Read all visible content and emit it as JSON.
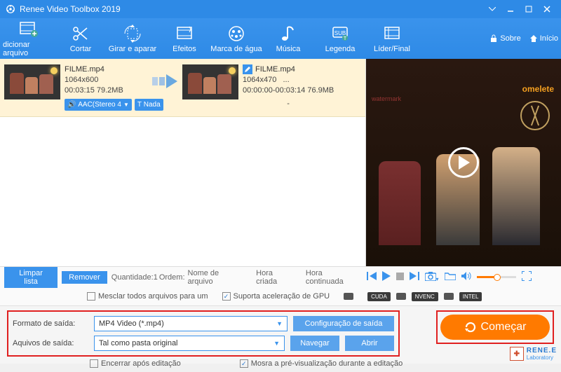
{
  "titlebar": {
    "title": "Renee Video Toolbox 2019"
  },
  "toolbar": {
    "items": [
      {
        "label": "dicionar arquivo"
      },
      {
        "label": "Cortar"
      },
      {
        "label": "Girar e aparar"
      },
      {
        "label": "Efeitos"
      },
      {
        "label": "Marca de água"
      },
      {
        "label": "Música"
      },
      {
        "label": "Legenda"
      },
      {
        "label": "Líder/Final"
      }
    ],
    "about": "Sobre",
    "home": "Início"
  },
  "file": {
    "src": {
      "name": "FILME.mp4",
      "res": "1064x600",
      "dur": "00:03:15  79.2MB",
      "audio": "AAC(Stereo 4",
      "sub": "Nada"
    },
    "dst": {
      "name": "FILME.mp4",
      "res": "1064x470",
      "resExtra": "...",
      "dur": "00:00:00-00:03:14  76.9MB",
      "dash": "-"
    }
  },
  "preview": {
    "watermark": "watermark",
    "brand": "omelete"
  },
  "listbar": {
    "clear": "Limpar lista",
    "remove": "Remover",
    "qty": "Quantidade:1",
    "order": "Ordem:",
    "byname": "Nome de arquivo",
    "bycreated": "Hora criada",
    "bycont": "Hora continuada"
  },
  "opts": {
    "merge": "Mesclar todos arquivos para um",
    "gpu": "Suporta aceleração de GPU",
    "cuda": "CUDA",
    "nvenc": "NVENC",
    "intel": "INTEL"
  },
  "out": {
    "format_lbl": "Formato de saída:",
    "format_val": "MP4 Video (*.mp4)",
    "cfg": "Configuração de saída",
    "files_lbl": "Aquivos de saída:",
    "files_val": "Tal como pasta original",
    "browse": "Navegar",
    "open": "Abrir"
  },
  "bottom": {
    "close_after": "Encerrar após editação",
    "show_preview": "Mosra a pré-visualização durante a editação"
  },
  "start": "Começar",
  "brandmark": {
    "name": "RENE.E",
    "sub": "Laboratory"
  }
}
